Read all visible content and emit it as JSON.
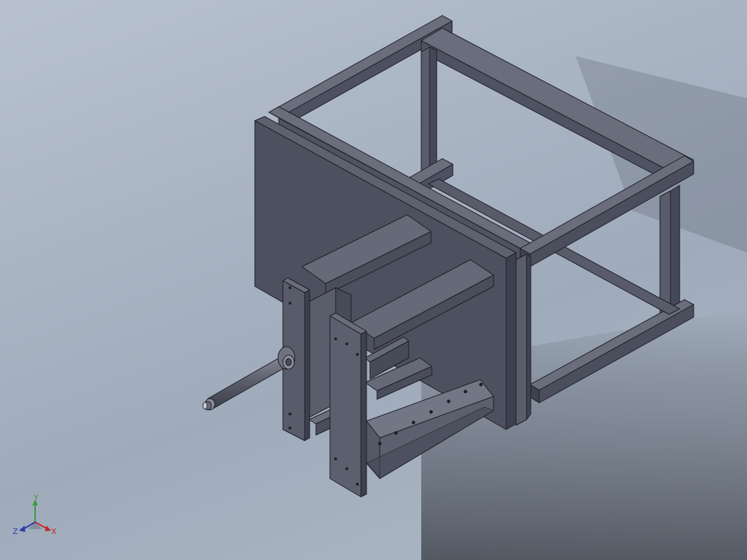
{
  "viewport": {
    "background_top": "#b8c2cf",
    "background_bottom": "#aeb8c5",
    "part_face_light": "#5f6270",
    "part_face_mid": "#4f5261",
    "part_face_dark": "#3f4250",
    "edge_color": "#1c1d24"
  },
  "triad": {
    "x_label": "X",
    "y_label": "Y",
    "z_label": "Z",
    "x_color": "#c0282d",
    "y_color": "#3a9a3a",
    "z_color": "#2b3aa8"
  }
}
